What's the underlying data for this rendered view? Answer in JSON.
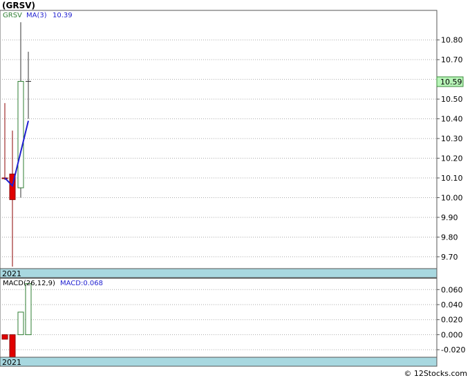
{
  "title": "(GRSV)",
  "footer": "© 12Stocks.com",
  "colors": {
    "up": "#2e7d32",
    "down": "#e00000",
    "ma": "#1f1fd0",
    "grid": "#aaaaaa",
    "date_band": "#a8d8e0",
    "price_tag_bg": "#b8f5b8"
  },
  "chart_data": [
    {
      "type": "candlestick",
      "name": "price",
      "legend": {
        "symbol": "GRSV",
        "ma_label": "MA(3)",
        "ma_value": "10.39"
      },
      "last_price": 10.59,
      "last_price_label": "10.59",
      "x_label": "2021",
      "ylim": [
        9.64,
        10.95
      ],
      "yticks": [
        9.7,
        9.8,
        9.9,
        10.0,
        10.1,
        10.2,
        10.3,
        10.4,
        10.5,
        10.6,
        10.7,
        10.8
      ],
      "ytick_labels": [
        "9.70",
        "9.80",
        "9.90",
        "10.00",
        "10.10",
        "10.20",
        "10.30",
        "10.40",
        "10.50",
        "10.60",
        "10.70",
        "10.80"
      ],
      "candles": [
        {
          "open": 10.1,
          "high": 10.48,
          "low": 10.09,
          "close": 10.1,
          "direction": "down"
        },
        {
          "open": 10.12,
          "high": 10.34,
          "low": 9.65,
          "close": 9.99,
          "direction": "down"
        },
        {
          "open": 10.05,
          "high": 10.89,
          "low": 10.0,
          "close": 10.59,
          "direction": "up"
        },
        {
          "open": 10.59,
          "high": 10.74,
          "low": 10.4,
          "close": 10.59,
          "direction": "neutral"
        }
      ],
      "ma": [
        10.1,
        10.06,
        10.39
      ]
    },
    {
      "type": "bar",
      "name": "macd",
      "legend": {
        "label": "MACD(26,12,9)",
        "value_label": "MACD:0.068"
      },
      "x_label": "2021",
      "ylim": [
        -0.03,
        0.075
      ],
      "yticks": [
        -0.02,
        0.0,
        0.02,
        0.04,
        0.06
      ],
      "ytick_labels": [
        "-0.020",
        "0.000",
        "0.020",
        "0.040",
        "0.060"
      ],
      "values": [
        -0.006,
        -0.03,
        0.03,
        0.068
      ],
      "direction": [
        "down",
        "down",
        "up",
        "up"
      ]
    }
  ]
}
